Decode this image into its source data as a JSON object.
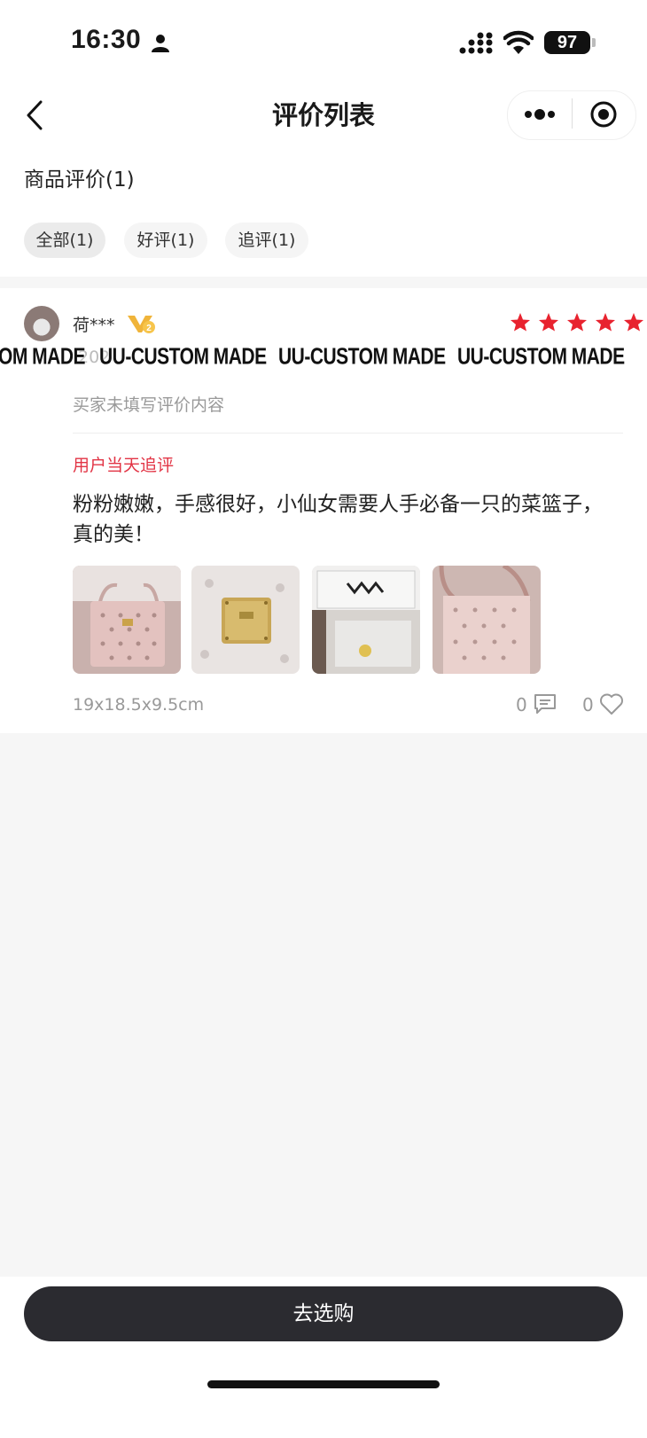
{
  "status_bar": {
    "time": "16:30",
    "battery": "97"
  },
  "nav": {
    "title": "评价列表"
  },
  "section": {
    "title": "商品评价(1)"
  },
  "filters": [
    {
      "label": "全部(1)",
      "active": true
    },
    {
      "label": "好评(1)",
      "active": false
    },
    {
      "label": "追评(1)",
      "active": false
    }
  ],
  "review": {
    "username": "荷***",
    "badge": "V2",
    "rating": 5,
    "date_fragment": "202",
    "watermark": "UU-CUSTOM MADE",
    "watermark_partial": "OM MADE",
    "content": "买家未填写评价内容",
    "followup_label": "用户当天追评",
    "followup_text": "粉粉嫩嫩，手感很好，小仙女需要人手必备一只的菜篮子，真的美！",
    "photos": [
      "pink-tote-bag-photo",
      "gold-logo-plate-photo",
      "gift-box-photo",
      "pink-tote-bag-closeup-photo"
    ],
    "size": "19x18.5x9.5cm",
    "comment_count": "0",
    "like_count": "0"
  },
  "bottom": {
    "buy_label": "去选购"
  },
  "colors": {
    "accent_red": "#e8232f",
    "button_dark": "#2b2b30",
    "badge_gold": "#f0b43a"
  }
}
